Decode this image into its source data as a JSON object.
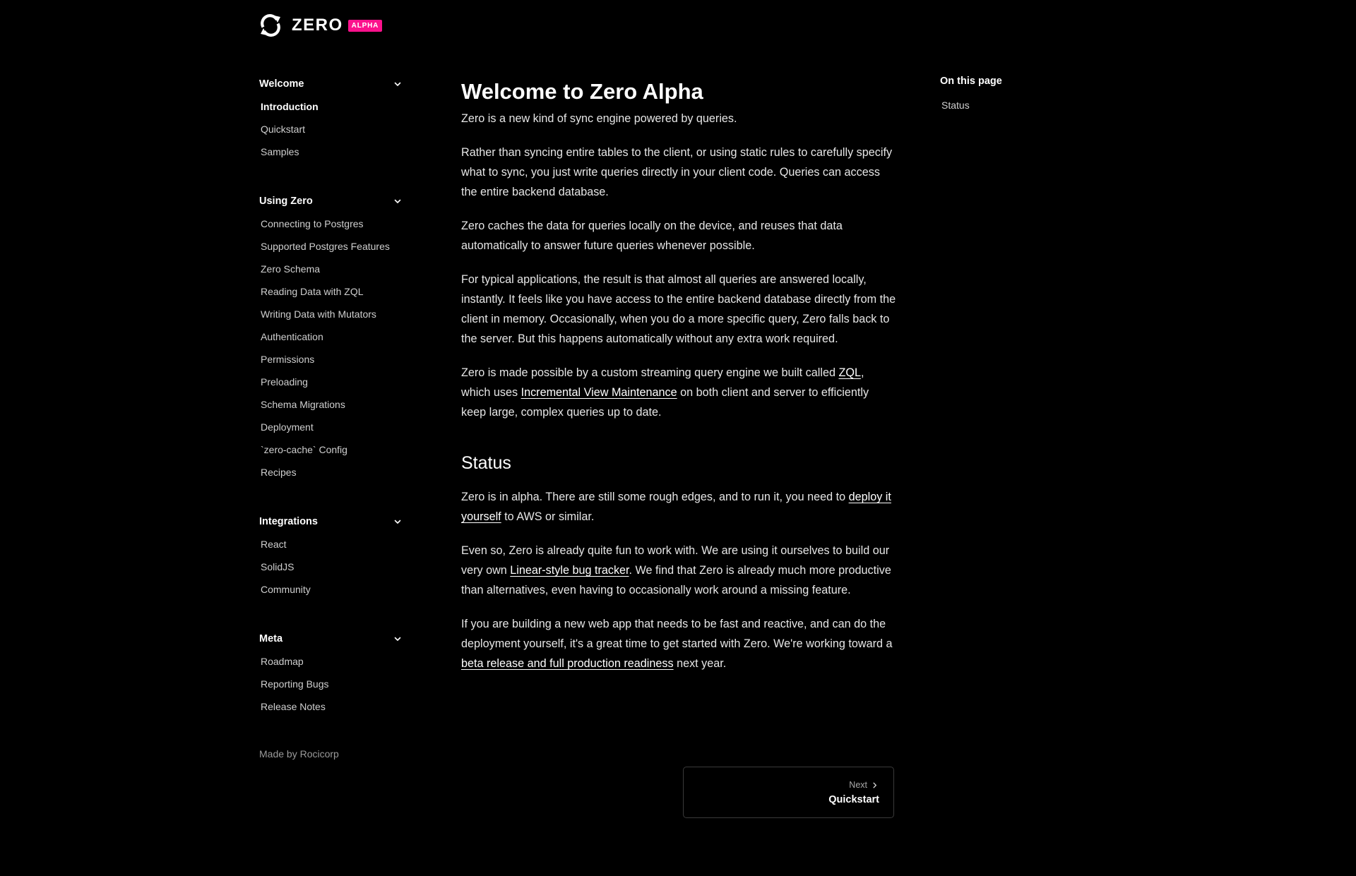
{
  "brand": {
    "name": "ZERO",
    "badge": "ALPHA",
    "accent_color": "#fc118c",
    "logo_icon": "sync-arrows-icon"
  },
  "sidebar": {
    "sections": [
      {
        "title": "Welcome",
        "items": [
          {
            "label": "Introduction",
            "active": true
          },
          {
            "label": "Quickstart"
          },
          {
            "label": "Samples"
          }
        ]
      },
      {
        "title": "Using Zero",
        "items": [
          {
            "label": "Connecting to Postgres"
          },
          {
            "label": "Supported Postgres Features"
          },
          {
            "label": "Zero Schema"
          },
          {
            "label": "Reading Data with ZQL"
          },
          {
            "label": "Writing Data with Mutators"
          },
          {
            "label": "Authentication"
          },
          {
            "label": "Permissions"
          },
          {
            "label": "Preloading"
          },
          {
            "label": "Schema Migrations"
          },
          {
            "label": "Deployment"
          },
          {
            "label": "`zero-cache` Config"
          },
          {
            "label": "Recipes"
          }
        ]
      },
      {
        "title": "Integrations",
        "items": [
          {
            "label": "React"
          },
          {
            "label": "SolidJS"
          },
          {
            "label": "Community"
          }
        ]
      },
      {
        "title": "Meta",
        "items": [
          {
            "label": "Roadmap"
          },
          {
            "label": "Reporting Bugs"
          },
          {
            "label": "Release Notes"
          }
        ]
      }
    ],
    "footer": "Made by Rocicorp"
  },
  "main": {
    "title": "Welcome to Zero Alpha",
    "intro": "Zero is a new kind of sync engine powered by queries.",
    "p2": "Rather than syncing entire tables to the client, or using static rules to carefully specify what to sync, you just write queries directly in your client code. Queries can access the entire backend database.",
    "p3": "Zero caches the data for queries locally on the device, and reuses that data automatically to answer future queries whenever possible.",
    "p4": "For typical applications, the result is that almost all queries are answered locally, instantly. It feels like you have access to the entire backend database directly from the client in memory. Occasionally, when you do a more specific query, Zero falls back to the server. But this happens automatically without any extra work required.",
    "p5": {
      "before": "Zero is made possible by a custom streaming query engine we built called ",
      "link1": "ZQL",
      "middle": ", which uses ",
      "link2": "Incremental View Maintenance",
      "after": " on both client and server to efficiently keep large, complex queries up to date."
    },
    "status_heading": "Status",
    "s1": {
      "before": "Zero is in alpha. There are still some rough edges, and to run it, you need to ",
      "link": "deploy it yourself",
      "after": " to AWS or similar."
    },
    "s2": {
      "before": "Even so, Zero is already quite fun to work with. We are using it ourselves to build our very own ",
      "link": "Linear-style bug tracker",
      "after": ". We find that Zero is already much more productive than alternatives, even having to occasionally work around a missing feature."
    },
    "s3": {
      "before": "If you are building a new web app that needs to be fast and reactive, and can do the deployment yourself, it's a great time to get started with Zero. We're working toward a ",
      "link": "beta release and full production readiness",
      "after": " next year."
    },
    "next": {
      "label": "Next",
      "title": "Quickstart"
    }
  },
  "toc": {
    "title": "On this page",
    "items": [
      "Status"
    ]
  }
}
